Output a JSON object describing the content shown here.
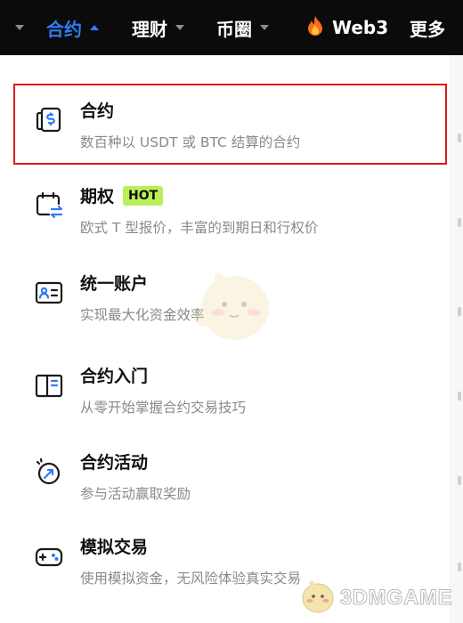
{
  "nav": {
    "items": [
      {
        "label": "合约",
        "active": true
      },
      {
        "label": "理财",
        "active": false
      },
      {
        "label": "币圈",
        "active": false
      },
      {
        "label": "Web3",
        "active": false
      },
      {
        "label": "更多",
        "active": false
      }
    ]
  },
  "menu": {
    "items": [
      {
        "title": "合约",
        "desc": "数百种以 USDT 或 BTC 结算的合约",
        "icon": "dollar-card-icon",
        "highlighted": true
      },
      {
        "title": "期权",
        "badge": "HOT",
        "desc": "欧式 T 型报价，丰富的到期日和行权价",
        "icon": "calendar-swap-icon"
      },
      {
        "title": "统一账户",
        "desc": "实现最大化资金效率",
        "icon": "id-card-icon"
      },
      {
        "title": "合约入门",
        "desc": "从零开始掌握合约交易技巧",
        "icon": "book-icon"
      },
      {
        "title": "合约活动",
        "desc": "参与活动赢取奖励",
        "icon": "activity-icon"
      },
      {
        "title": "模拟交易",
        "desc": "使用模拟资金，无风险体验真实交易",
        "icon": "gamepad-icon"
      }
    ]
  },
  "watermark": {
    "text": "3DMGAME"
  },
  "colors": {
    "accent": "#2f7cf6",
    "nav_bg": "#0b0b0b",
    "badge_bg": "#b8f05a",
    "highlight_border": "#d81b1b"
  }
}
